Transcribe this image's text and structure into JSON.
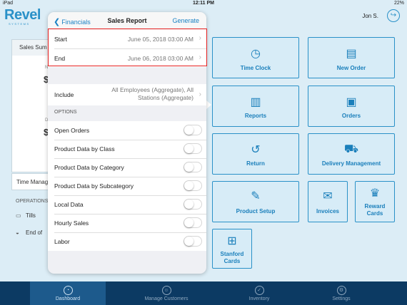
{
  "status_bar": {
    "carrier": "iPad",
    "time": "12:11 PM",
    "battery": "22%"
  },
  "app": {
    "logo": "Revel",
    "logo_sub": "SYSTEMS"
  },
  "header": {
    "user": "Jon S."
  },
  "left_panel": {
    "header": "Sales Sum",
    "dollar1": "$",
    "dollar2": "$",
    "time_mgmt": "Time Manag",
    "operations_label": "OPERATIONS",
    "ops_items": [
      {
        "label": "Tills",
        "icon": "till-icon"
      },
      {
        "label": "End of",
        "icon": "sunset-icon"
      }
    ]
  },
  "tiles": [
    {
      "label": "Time Clock",
      "icon": "clock-icon"
    },
    {
      "label": "New Order",
      "icon": "document-icon"
    },
    {
      "label": "Reports",
      "icon": "chart-icon"
    },
    {
      "label": "Orders",
      "icon": "orders-icon"
    },
    {
      "label": "Return",
      "icon": "return-icon"
    },
    {
      "label": "Delivery Management",
      "icon": "truck-icon"
    },
    {
      "label": "Product Setup",
      "icon": "wrench-icon"
    },
    {
      "label": "Invoices",
      "icon": "envelope-icon"
    },
    {
      "label": "Reward Cards",
      "icon": "trophy-icon"
    },
    {
      "label": "Stanford Cards",
      "icon": "gift-icon"
    }
  ],
  "popover": {
    "back_label": "Financials",
    "title": "Sales Report",
    "generate_label": "Generate",
    "start_label": "Start",
    "start_value": "June 05, 2018 03:00 AM",
    "end_label": "End",
    "end_value": "June 06, 2018 03:00 AM",
    "include_label": "Include",
    "include_value_line1": "All Employees (Aggregate), All",
    "include_value_line2": "Stations (Aggregate)",
    "options_header": "OPTIONS",
    "options": [
      {
        "label": "Open Orders",
        "on": false
      },
      {
        "label": "Product Data by Class",
        "on": false
      },
      {
        "label": "Product Data by Category",
        "on": false
      },
      {
        "label": "Product Data by Subcategory",
        "on": false
      },
      {
        "label": "Local Data",
        "on": false
      },
      {
        "label": "Hourly Sales",
        "on": false
      },
      {
        "label": "Labor",
        "on": false
      }
    ]
  },
  "bottom_nav": [
    {
      "label": "Dashboard",
      "icon": "dashboard-icon",
      "active": true
    },
    {
      "label": "Manage Customers",
      "icon": "customers-icon",
      "active": false
    },
    {
      "label": "Inventory",
      "icon": "inventory-icon",
      "active": false
    },
    {
      "label": "Settings",
      "icon": "settings-icon",
      "active": false
    }
  ],
  "colors": {
    "accent": "#2a91c8",
    "nav_bg": "#0c3a63",
    "highlight": "#e52020"
  }
}
